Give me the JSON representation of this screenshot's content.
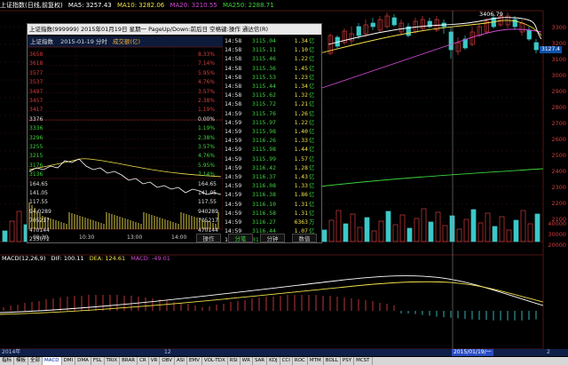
{
  "title_bar": {
    "name": "上证指数(日线,前复权)",
    "ma5": "MA5: 3257.43",
    "ma10": "MA10: 3282.06",
    "ma20": "MA20: 3210.55",
    "ma250": "MA250: 2288.71",
    "colors": {
      "name": "#ffffff",
      "ma5": "#ffffff",
      "ma10": "#f2e04a",
      "ma20": "#d04ad0",
      "ma250": "#3cd23c"
    }
  },
  "right_axis": [
    "3300",
    "3200",
    "3100",
    "3000",
    "2900",
    "2800",
    "2700",
    "2600",
    "2500",
    "2400",
    "2300",
    "2200",
    "2100"
  ],
  "volume_axis": [
    "40000",
    "30000",
    "20000"
  ],
  "mark_label": "3406.79",
  "price_tag": "3127.4",
  "popup": {
    "title": "上证指数(999999)  2015年01月19日 星期一  PageUp/Down:前后日  空格键:操作  通达信(R)",
    "mini_header": {
      "name": "上证指数",
      "date": "2015-01-19 分时",
      "suffix": "成交额(亿)"
    },
    "left_axis": [
      "3658",
      "3618",
      "3577",
      "3537",
      "3497",
      "3457",
      "3417",
      "3376",
      "3336",
      "3296",
      "3255",
      "3215",
      "3176",
      "3136",
      "164.65",
      "141.05",
      "117.55",
      "94,0289",
      "705217",
      "470144",
      "235072"
    ],
    "right_axis": [
      "8.33%",
      "7.14%",
      "5.95%",
      "4.76%",
      "3.57%",
      "2.38%",
      "1.19%",
      "0.00%",
      "1.19%",
      "2.38%",
      "3.57%",
      "4.76%",
      "5.95%",
      "7.14%",
      "164.65",
      "141.05",
      "117.55",
      "940289",
      "705217",
      "470144",
      "235072"
    ],
    "time_axis": [
      "09:30",
      "10:30",
      "13:00",
      "14:00"
    ],
    "ticks": [
      {
        "time": "14:58",
        "price": "3115.04",
        "vol": "1.34",
        "bs": "亿"
      },
      {
        "time": "14:58",
        "price": "3115.11",
        "vol": "1.10",
        "bs": "亿"
      },
      {
        "time": "14:58",
        "price": "3115.46",
        "vol": "1.22",
        "bs": "亿"
      },
      {
        "time": "14:58",
        "price": "3115.36",
        "vol": "1.45",
        "bs": "亿"
      },
      {
        "time": "14:58",
        "price": "3115.53",
        "vol": "1.23",
        "bs": "亿"
      },
      {
        "time": "14:58",
        "price": "3115.44",
        "vol": "1.34",
        "bs": "亿"
      },
      {
        "time": "14:58",
        "price": "3115.62",
        "vol": "1.32",
        "bs": "亿"
      },
      {
        "time": "14:58",
        "price": "3115.72",
        "vol": "1.21",
        "bs": "亿"
      },
      {
        "time": "14:59",
        "price": "3115.76",
        "vol": "1.26",
        "bs": "亿"
      },
      {
        "time": "14:59",
        "price": "3115.97",
        "vol": "1.22",
        "bs": "亿"
      },
      {
        "time": "14:59",
        "price": "3115.98",
        "vol": "1.40",
        "bs": "亿"
      },
      {
        "time": "14:59",
        "price": "3116.26",
        "vol": "1.33",
        "bs": "亿"
      },
      {
        "time": "14:59",
        "price": "3115.98",
        "vol": "1.44",
        "bs": "亿"
      },
      {
        "time": "14:59",
        "price": "3115.99",
        "vol": "1.57",
        "bs": "亿"
      },
      {
        "time": "14:59",
        "price": "3116.42",
        "vol": "1.28",
        "bs": "亿"
      },
      {
        "time": "14:59",
        "price": "3116.37",
        "vol": "1.43",
        "bs": "亿"
      },
      {
        "time": "14:59",
        "price": "3116.08",
        "vol": "1.33",
        "bs": "亿"
      },
      {
        "time": "14:59",
        "price": "3116.38",
        "vol": "1.86",
        "bs": "亿"
      },
      {
        "time": "14:59",
        "price": "3116.10",
        "vol": "1.31",
        "bs": "亿"
      },
      {
        "time": "14:59",
        "price": "3116.58",
        "vol": "1.31",
        "bs": "亿"
      },
      {
        "time": "14:59",
        "price": "3116.27",
        "vol": "6363",
        "bs": "万"
      },
      {
        "time": "14:59",
        "price": "3116.44",
        "vol": "1.07",
        "bs": "亿"
      },
      {
        "time": "14:59",
        "price": "3116.35",
        "vol": "0.00",
        "bs": "亿"
      }
    ],
    "tabs": [
      "操作",
      "分笔",
      "分钟",
      "数值"
    ],
    "active_tab": 1
  },
  "macd_label": {
    "name": "MACD(12,26,9)",
    "dif": "DIF: 100.11",
    "dea": "DEA: 124.61",
    "macd": "MACD: -49.01"
  },
  "time_axis": [
    "2014年",
    "12",
    "2015/01/19/一",
    "2"
  ],
  "bottom_tabs": [
    "指标",
    "模板",
    "全部",
    "MACD",
    "DMI",
    "DMA",
    "FSL",
    "TRIX",
    "BRAR",
    "CR",
    "VR",
    "OBV",
    "ASI",
    "EMV",
    "VOL-TDX",
    "RSI",
    "WR",
    "SAR",
    "KDJ",
    "CCI",
    "ROC",
    "MTM",
    "BOLL",
    "PSY",
    "MCST"
  ],
  "active_bottom_tab": 3
}
